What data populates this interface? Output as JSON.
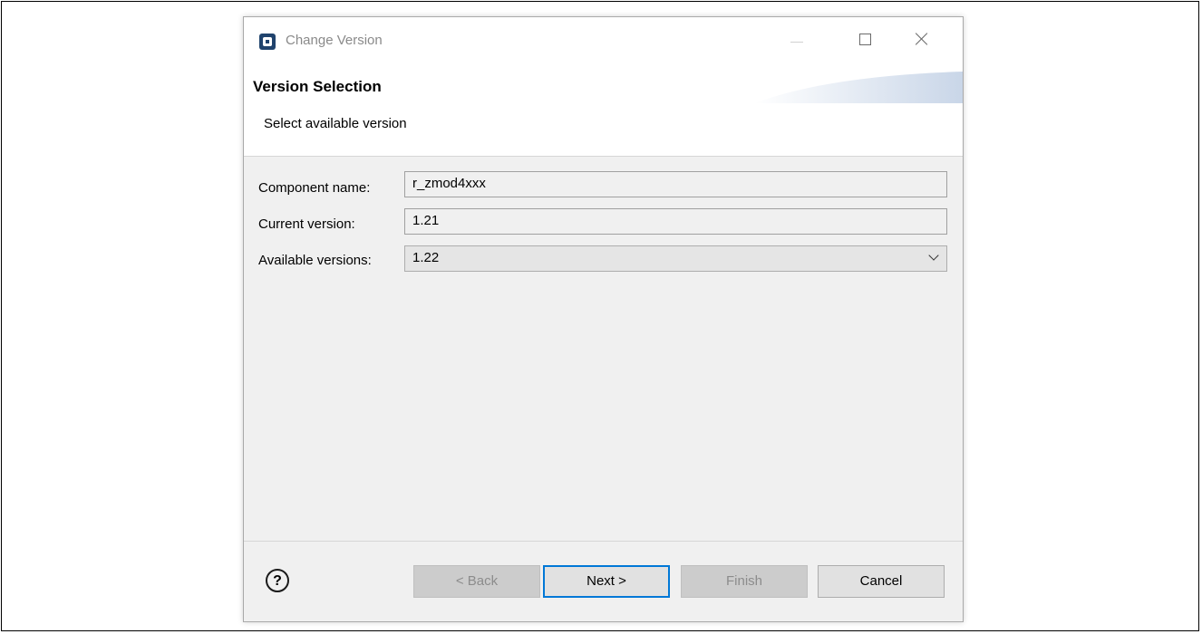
{
  "window": {
    "title": "Change Version",
    "icon": "e2-studio-app-icon"
  },
  "banner": {
    "title": "Version Selection",
    "description": "Select available version"
  },
  "form": {
    "component_name_label": "Component name:",
    "component_name_value": "r_zmod4xxx",
    "current_version_label": "Current version:",
    "current_version_value": "1.21",
    "available_versions_label": "Available versions:",
    "available_versions_selected": "1.22"
  },
  "footer": {
    "help_glyph": "?",
    "back_label": "< Back",
    "next_label": "Next >",
    "finish_label": "Finish",
    "cancel_label": "Cancel"
  },
  "colors": {
    "accent": "#0078d7",
    "dialog_bg": "#f0f0f0",
    "app_icon": "#20436d"
  }
}
